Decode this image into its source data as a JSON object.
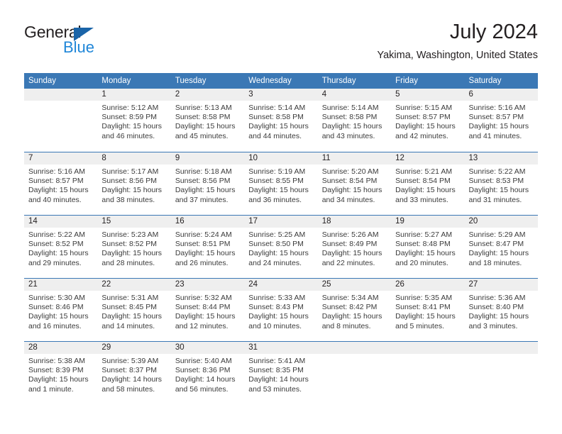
{
  "logo": {
    "word_one": "General",
    "word_two": "Blue",
    "triangle_color": "#1a64a8",
    "blue_text_color": "#1f86d8"
  },
  "header": {
    "title": "July 2024",
    "location": "Yakima, Washington, United States",
    "accent_color": "#3b78b5",
    "band_color": "#efefef"
  },
  "weekdays": [
    "Sunday",
    "Monday",
    "Tuesday",
    "Wednesday",
    "Thursday",
    "Friday",
    "Saturday"
  ],
  "weeks": [
    [
      {
        "day": "",
        "sunrise": "",
        "sunset": "",
        "daylight_line1": "",
        "daylight_line2": ""
      },
      {
        "day": "1",
        "sunrise": "Sunrise: 5:12 AM",
        "sunset": "Sunset: 8:59 PM",
        "daylight_line1": "Daylight: 15 hours",
        "daylight_line2": "and 46 minutes."
      },
      {
        "day": "2",
        "sunrise": "Sunrise: 5:13 AM",
        "sunset": "Sunset: 8:58 PM",
        "daylight_line1": "Daylight: 15 hours",
        "daylight_line2": "and 45 minutes."
      },
      {
        "day": "3",
        "sunrise": "Sunrise: 5:14 AM",
        "sunset": "Sunset: 8:58 PM",
        "daylight_line1": "Daylight: 15 hours",
        "daylight_line2": "and 44 minutes."
      },
      {
        "day": "4",
        "sunrise": "Sunrise: 5:14 AM",
        "sunset": "Sunset: 8:58 PM",
        "daylight_line1": "Daylight: 15 hours",
        "daylight_line2": "and 43 minutes."
      },
      {
        "day": "5",
        "sunrise": "Sunrise: 5:15 AM",
        "sunset": "Sunset: 8:57 PM",
        "daylight_line1": "Daylight: 15 hours",
        "daylight_line2": "and 42 minutes."
      },
      {
        "day": "6",
        "sunrise": "Sunrise: 5:16 AM",
        "sunset": "Sunset: 8:57 PM",
        "daylight_line1": "Daylight: 15 hours",
        "daylight_line2": "and 41 minutes."
      }
    ],
    [
      {
        "day": "7",
        "sunrise": "Sunrise: 5:16 AM",
        "sunset": "Sunset: 8:57 PM",
        "daylight_line1": "Daylight: 15 hours",
        "daylight_line2": "and 40 minutes."
      },
      {
        "day": "8",
        "sunrise": "Sunrise: 5:17 AM",
        "sunset": "Sunset: 8:56 PM",
        "daylight_line1": "Daylight: 15 hours",
        "daylight_line2": "and 38 minutes."
      },
      {
        "day": "9",
        "sunrise": "Sunrise: 5:18 AM",
        "sunset": "Sunset: 8:56 PM",
        "daylight_line1": "Daylight: 15 hours",
        "daylight_line2": "and 37 minutes."
      },
      {
        "day": "10",
        "sunrise": "Sunrise: 5:19 AM",
        "sunset": "Sunset: 8:55 PM",
        "daylight_line1": "Daylight: 15 hours",
        "daylight_line2": "and 36 minutes."
      },
      {
        "day": "11",
        "sunrise": "Sunrise: 5:20 AM",
        "sunset": "Sunset: 8:54 PM",
        "daylight_line1": "Daylight: 15 hours",
        "daylight_line2": "and 34 minutes."
      },
      {
        "day": "12",
        "sunrise": "Sunrise: 5:21 AM",
        "sunset": "Sunset: 8:54 PM",
        "daylight_line1": "Daylight: 15 hours",
        "daylight_line2": "and 33 minutes."
      },
      {
        "day": "13",
        "sunrise": "Sunrise: 5:22 AM",
        "sunset": "Sunset: 8:53 PM",
        "daylight_line1": "Daylight: 15 hours",
        "daylight_line2": "and 31 minutes."
      }
    ],
    [
      {
        "day": "14",
        "sunrise": "Sunrise: 5:22 AM",
        "sunset": "Sunset: 8:52 PM",
        "daylight_line1": "Daylight: 15 hours",
        "daylight_line2": "and 29 minutes."
      },
      {
        "day": "15",
        "sunrise": "Sunrise: 5:23 AM",
        "sunset": "Sunset: 8:52 PM",
        "daylight_line1": "Daylight: 15 hours",
        "daylight_line2": "and 28 minutes."
      },
      {
        "day": "16",
        "sunrise": "Sunrise: 5:24 AM",
        "sunset": "Sunset: 8:51 PM",
        "daylight_line1": "Daylight: 15 hours",
        "daylight_line2": "and 26 minutes."
      },
      {
        "day": "17",
        "sunrise": "Sunrise: 5:25 AM",
        "sunset": "Sunset: 8:50 PM",
        "daylight_line1": "Daylight: 15 hours",
        "daylight_line2": "and 24 minutes."
      },
      {
        "day": "18",
        "sunrise": "Sunrise: 5:26 AM",
        "sunset": "Sunset: 8:49 PM",
        "daylight_line1": "Daylight: 15 hours",
        "daylight_line2": "and 22 minutes."
      },
      {
        "day": "19",
        "sunrise": "Sunrise: 5:27 AM",
        "sunset": "Sunset: 8:48 PM",
        "daylight_line1": "Daylight: 15 hours",
        "daylight_line2": "and 20 minutes."
      },
      {
        "day": "20",
        "sunrise": "Sunrise: 5:29 AM",
        "sunset": "Sunset: 8:47 PM",
        "daylight_line1": "Daylight: 15 hours",
        "daylight_line2": "and 18 minutes."
      }
    ],
    [
      {
        "day": "21",
        "sunrise": "Sunrise: 5:30 AM",
        "sunset": "Sunset: 8:46 PM",
        "daylight_line1": "Daylight: 15 hours",
        "daylight_line2": "and 16 minutes."
      },
      {
        "day": "22",
        "sunrise": "Sunrise: 5:31 AM",
        "sunset": "Sunset: 8:45 PM",
        "daylight_line1": "Daylight: 15 hours",
        "daylight_line2": "and 14 minutes."
      },
      {
        "day": "23",
        "sunrise": "Sunrise: 5:32 AM",
        "sunset": "Sunset: 8:44 PM",
        "daylight_line1": "Daylight: 15 hours",
        "daylight_line2": "and 12 minutes."
      },
      {
        "day": "24",
        "sunrise": "Sunrise: 5:33 AM",
        "sunset": "Sunset: 8:43 PM",
        "daylight_line1": "Daylight: 15 hours",
        "daylight_line2": "and 10 minutes."
      },
      {
        "day": "25",
        "sunrise": "Sunrise: 5:34 AM",
        "sunset": "Sunset: 8:42 PM",
        "daylight_line1": "Daylight: 15 hours",
        "daylight_line2": "and 8 minutes."
      },
      {
        "day": "26",
        "sunrise": "Sunrise: 5:35 AM",
        "sunset": "Sunset: 8:41 PM",
        "daylight_line1": "Daylight: 15 hours",
        "daylight_line2": "and 5 minutes."
      },
      {
        "day": "27",
        "sunrise": "Sunrise: 5:36 AM",
        "sunset": "Sunset: 8:40 PM",
        "daylight_line1": "Daylight: 15 hours",
        "daylight_line2": "and 3 minutes."
      }
    ],
    [
      {
        "day": "28",
        "sunrise": "Sunrise: 5:38 AM",
        "sunset": "Sunset: 8:39 PM",
        "daylight_line1": "Daylight: 15 hours",
        "daylight_line2": "and 1 minute."
      },
      {
        "day": "29",
        "sunrise": "Sunrise: 5:39 AM",
        "sunset": "Sunset: 8:37 PM",
        "daylight_line1": "Daylight: 14 hours",
        "daylight_line2": "and 58 minutes."
      },
      {
        "day": "30",
        "sunrise": "Sunrise: 5:40 AM",
        "sunset": "Sunset: 8:36 PM",
        "daylight_line1": "Daylight: 14 hours",
        "daylight_line2": "and 56 minutes."
      },
      {
        "day": "31",
        "sunrise": "Sunrise: 5:41 AM",
        "sunset": "Sunset: 8:35 PM",
        "daylight_line1": "Daylight: 14 hours",
        "daylight_line2": "and 53 minutes."
      },
      {
        "day": "",
        "sunrise": "",
        "sunset": "",
        "daylight_line1": "",
        "daylight_line2": ""
      },
      {
        "day": "",
        "sunrise": "",
        "sunset": "",
        "daylight_line1": "",
        "daylight_line2": ""
      },
      {
        "day": "",
        "sunrise": "",
        "sunset": "",
        "daylight_line1": "",
        "daylight_line2": ""
      }
    ]
  ]
}
